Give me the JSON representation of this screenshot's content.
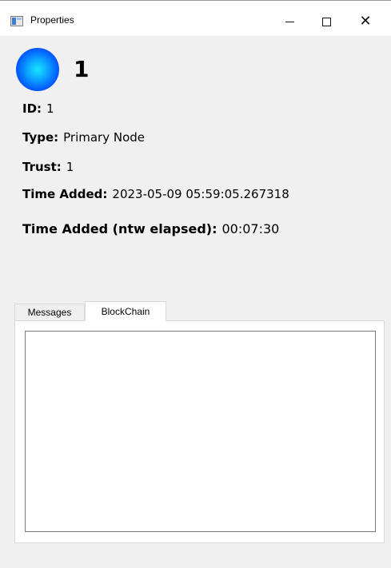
{
  "window": {
    "title": "Properties",
    "controls": {
      "minimize": "minimize",
      "maximize": "maximize",
      "close": "✕"
    }
  },
  "node": {
    "name": "1",
    "circle_color": "#0a7cff"
  },
  "properties": {
    "id_label": "ID:",
    "id_value": "1",
    "type_label": "Type:",
    "type_value": "Primary Node",
    "trust_label": "Trust:",
    "trust_value": "1",
    "time_added_label": "Time Added:",
    "time_added_value": "2023-05-09 05:59:05.267318",
    "elapsed_label": "Time Added (ntw elapsed):",
    "elapsed_value": "00:07:30"
  },
  "tabs": [
    {
      "label": "Messages",
      "active": false
    },
    {
      "label": "BlockChain",
      "active": true
    }
  ],
  "blockchain": {
    "content": ""
  }
}
